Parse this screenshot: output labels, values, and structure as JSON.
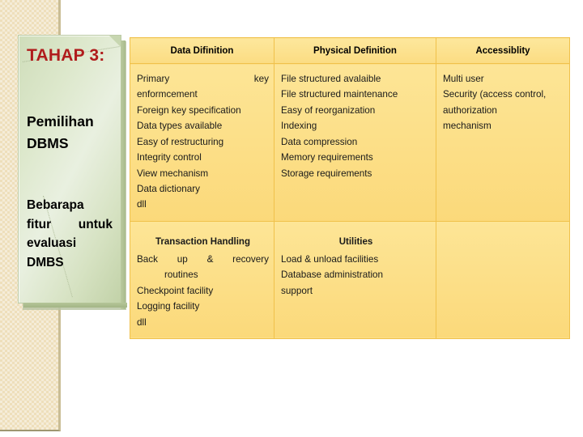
{
  "slide": {
    "title_box": {
      "stage_label": "TAHAP 3:",
      "heading_line1": "Pemilihan",
      "heading_line2": "DBMS",
      "subheading_line1": "Bebarapa",
      "subheading_line2": "fitur untuk",
      "subheading_line3": "evaluasi",
      "subheading_line4": "DMBS"
    },
    "accent_colors": {
      "stage_red": "#B01C1C",
      "table_fill": "#FDE18C",
      "table_border": "#F0C14B",
      "band_beige": "#EEDFBB",
      "box_green": "#DDE8CC"
    },
    "table": {
      "row1": {
        "headers": [
          "Data Difinition",
          "Physical Definition",
          "Accessiblity"
        ],
        "cells": [
          {
            "items": [
              "Primary key",
              "enformcement",
              "Foreign key specification",
              "Data types available",
              "Easy of restructuring",
              "Integrity control",
              "View mechanism",
              "Data dictionary",
              "dll"
            ]
          },
          {
            "items": [
              "File structured avalaible",
              "File structured maintenance",
              "Easy of reorganization",
              "Indexing",
              "Data compression",
              "Memory requirements",
              "Storage requirements"
            ]
          },
          {
            "items": [
              "Multi user",
              "Security (access control,",
              "authorization",
              "mechanism"
            ]
          }
        ]
      },
      "row2": {
        "headers": [
          "Transaction Handling",
          "Utilities",
          ""
        ],
        "cells": [
          {
            "items": [
              "Back up & recovery",
              "routines",
              "Checkpoint facility",
              "Logging facility",
              "dll"
            ]
          },
          {
            "items": [
              "Load & unload facilities",
              "Database administration",
              "support"
            ]
          },
          {
            "items": []
          }
        ]
      }
    }
  }
}
